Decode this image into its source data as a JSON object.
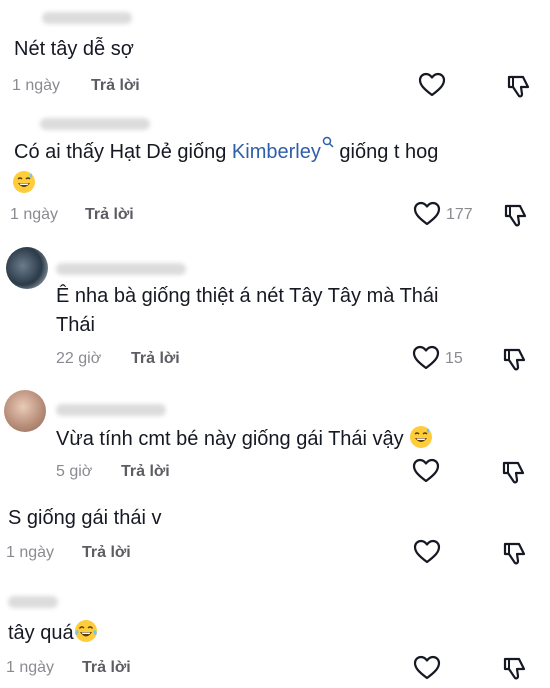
{
  "comments": [
    {
      "text": "Nét tây dễ sợ",
      "time": "1 ngày",
      "reply": "Trả lời",
      "likes": ""
    },
    {
      "text_before": "Có ai thấy Hạt Dẻ giống ",
      "mention": "Kimberley",
      "text_after": " giống t hog",
      "emoji": "grinning-sweat",
      "time": "1 ngày",
      "reply": "Trả lời",
      "likes": "177"
    },
    {
      "text_line1": "Ê nha bà giống thiệt á nét Tây Tây mà Thái",
      "text_line2": "Thái",
      "time": "22 giờ",
      "reply": "Trả lời",
      "likes": "15"
    },
    {
      "text": "Vừa tính cmt bé này giống gái Thái vậy",
      "emoji": "grinning-sweat",
      "time": "5 giờ",
      "reply": "Trả lời",
      "likes": ""
    },
    {
      "text": "S giống gái thái v",
      "time": "1 ngày",
      "reply": "Trả lời",
      "likes": ""
    },
    {
      "text": "tây quá",
      "emoji": "tears-of-joy",
      "time": "1 ngày",
      "reply": "Trả lời",
      "likes": ""
    }
  ],
  "icons": {
    "like": "heart-outline-icon",
    "dislike": "thumbs-down-outline-icon",
    "mention_search": "search-icon"
  },
  "colors": {
    "text": "#161823",
    "meta": "#8a8b91",
    "mention": "#2f5fa8"
  }
}
